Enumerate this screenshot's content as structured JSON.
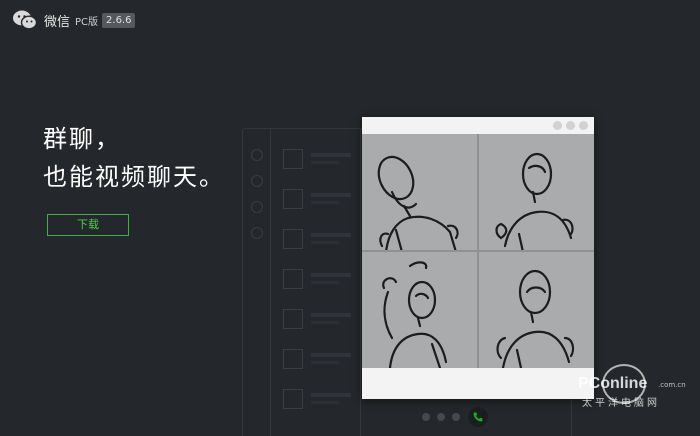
{
  "header": {
    "logo_icon": "wechat-logo-icon",
    "app_name": "微信",
    "platform": "PC版",
    "version": "2.6.6"
  },
  "hero": {
    "line1": "群聊，",
    "line2": "也能视频聊天。",
    "download_label": "下载"
  },
  "preview": {
    "tiles": [
      "sketch-figure-1",
      "sketch-figure-2",
      "sketch-figure-3",
      "sketch-figure-4"
    ]
  },
  "pager": {
    "dots": 3,
    "active_icon": "phone-call-icon",
    "accent": "#1aad19"
  },
  "watermark": {
    "brand": "PConline",
    "domain": ".com.cn",
    "cn": "太平洋电脑网"
  },
  "colors": {
    "background": "#24272b",
    "accent": "#3fb13f"
  }
}
